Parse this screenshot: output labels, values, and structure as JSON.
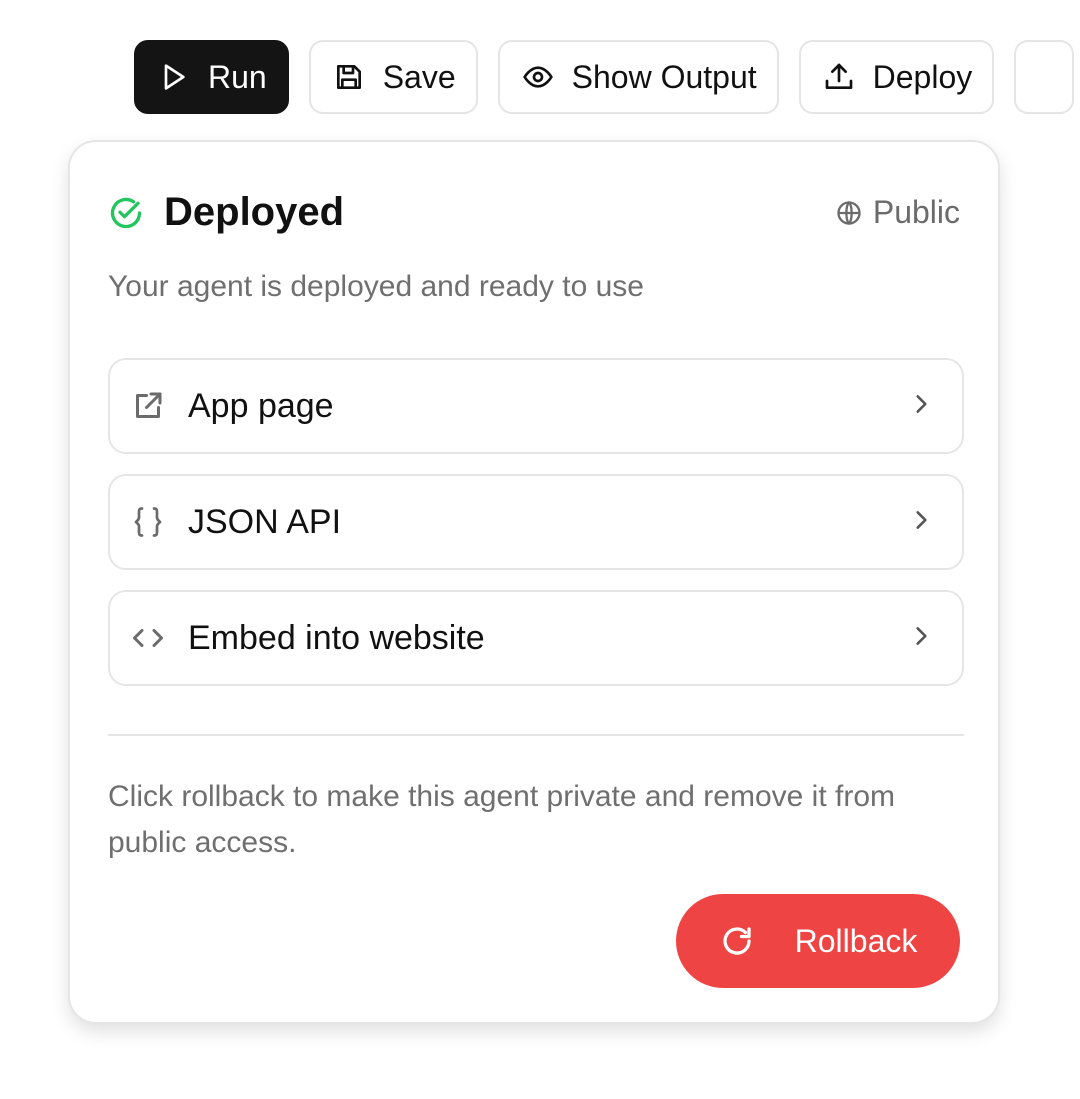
{
  "toolbar": {
    "run_label": "Run",
    "save_label": "Save",
    "show_output_label": "Show Output",
    "deploy_label": "Deploy"
  },
  "panel": {
    "status_title": "Deployed",
    "status_color": "#22c55e",
    "visibility": "Public",
    "subtitle": "Your agent is deployed and ready to use",
    "links": [
      {
        "label": "App page",
        "icon": "external-link-icon"
      },
      {
        "label": "JSON API",
        "icon": "braces-icon"
      },
      {
        "label": "Embed into website",
        "icon": "code-icon"
      }
    ],
    "rollback_note": "Click rollback to make this agent private and remove it from public access.",
    "rollback_label": "Rollback",
    "rollback_color": "#ef4444"
  }
}
